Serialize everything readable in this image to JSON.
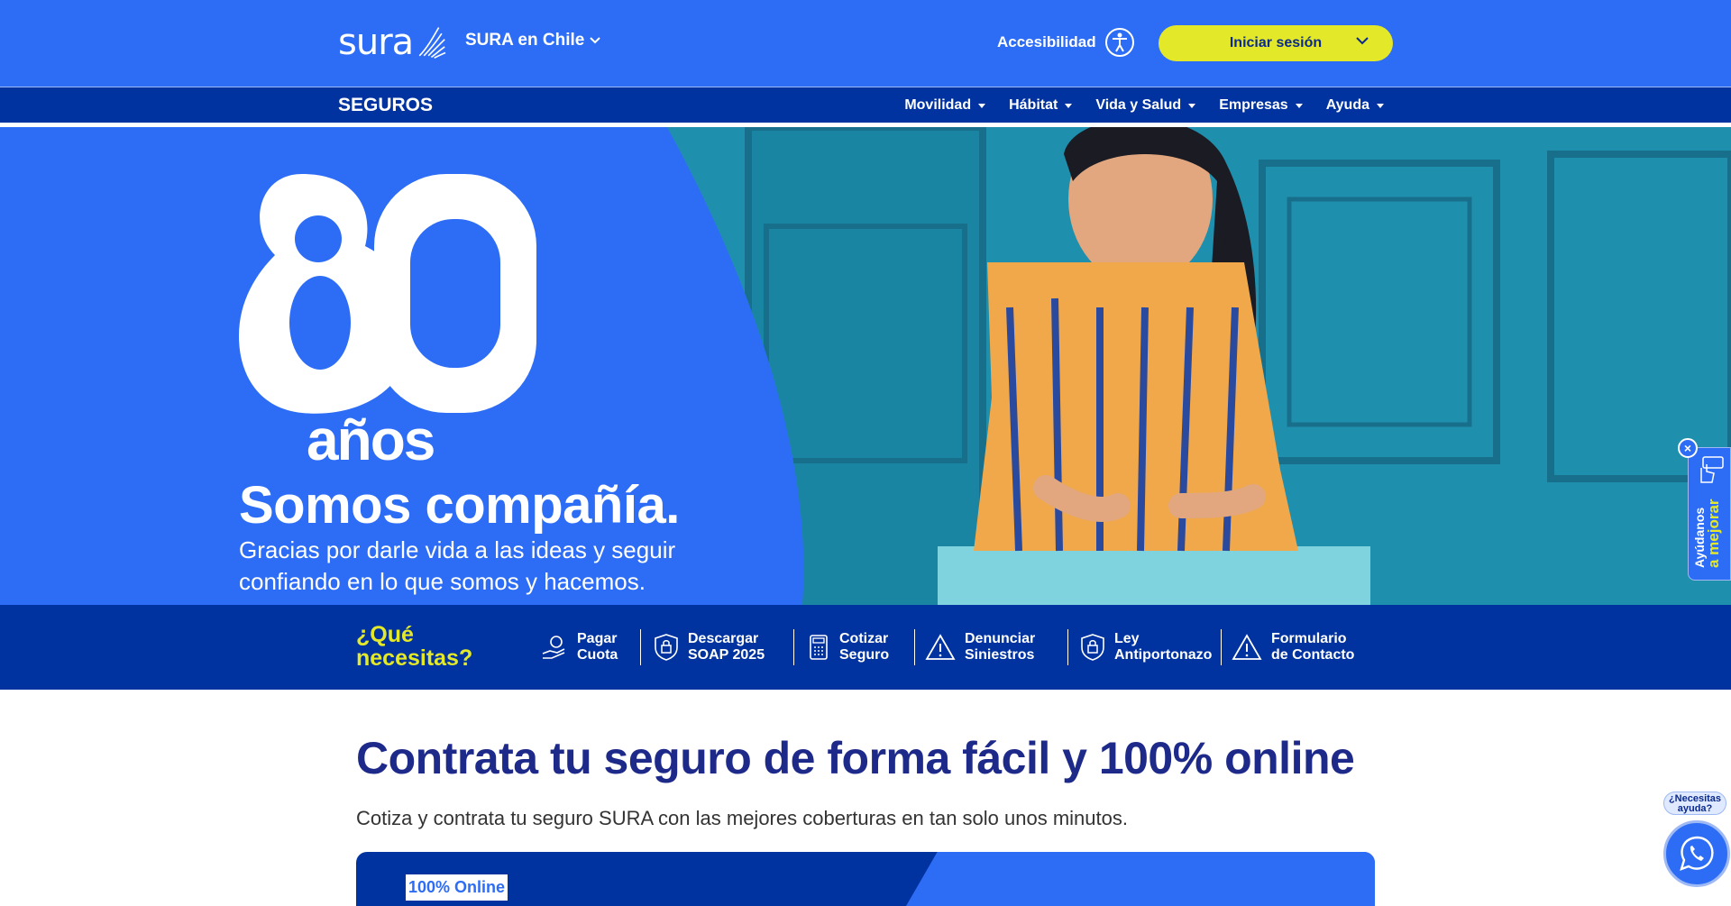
{
  "header": {
    "logo_text": "sura",
    "country_label": "SURA en Chile",
    "accessibility_label": "Accesibilidad",
    "login_label": "Iniciar sesión"
  },
  "nav": {
    "title": "SEGUROS",
    "items": [
      {
        "label": "Movilidad"
      },
      {
        "label": "Hábitat"
      },
      {
        "label": "Vida y Salud"
      },
      {
        "label": "Empresas"
      },
      {
        "label": "Ayuda"
      }
    ]
  },
  "hero": {
    "number": "80",
    "years": "años",
    "title": "Somos compañía.",
    "subtitle": "Gracias por darle vida a las ideas y seguir confiando en lo que somos y hacemos."
  },
  "feedback": {
    "line1": "Ayúdanos",
    "line2": "a mejorar",
    "close": "×"
  },
  "quick": {
    "question_line1": "¿Qué",
    "question_line2": "necesitas?",
    "actions": [
      {
        "label": "Pagar\nCuota",
        "icon": "hand-coin-icon"
      },
      {
        "label": "Descargar\nSOAP 2025",
        "icon": "shield-lock-icon"
      },
      {
        "label": "Cotizar\nSeguro",
        "icon": "calculator-icon"
      },
      {
        "label": "Denunciar\nSiniestros",
        "icon": "warning-icon"
      },
      {
        "label": "Ley\nAntiportonazo",
        "icon": "shield-lock-icon"
      },
      {
        "label": "Formulario\nde Contacto",
        "icon": "warning-icon"
      }
    ]
  },
  "content": {
    "title": "Contrata tu seguro de forma fácil y 100% online",
    "subtitle": "Cotiza y contrata tu seguro SURA con las mejores coberturas en tan solo unos minutos.",
    "promo_badge": "100% Online"
  },
  "help": {
    "bubble_line1": "¿Necesitas",
    "bubble_line2": "ayuda?"
  },
  "colors": {
    "primary_blue": "#2d6df6",
    "dark_blue": "#0033a0",
    "accent_yellow": "#e3e829",
    "title_navy": "#1e2a8a"
  }
}
